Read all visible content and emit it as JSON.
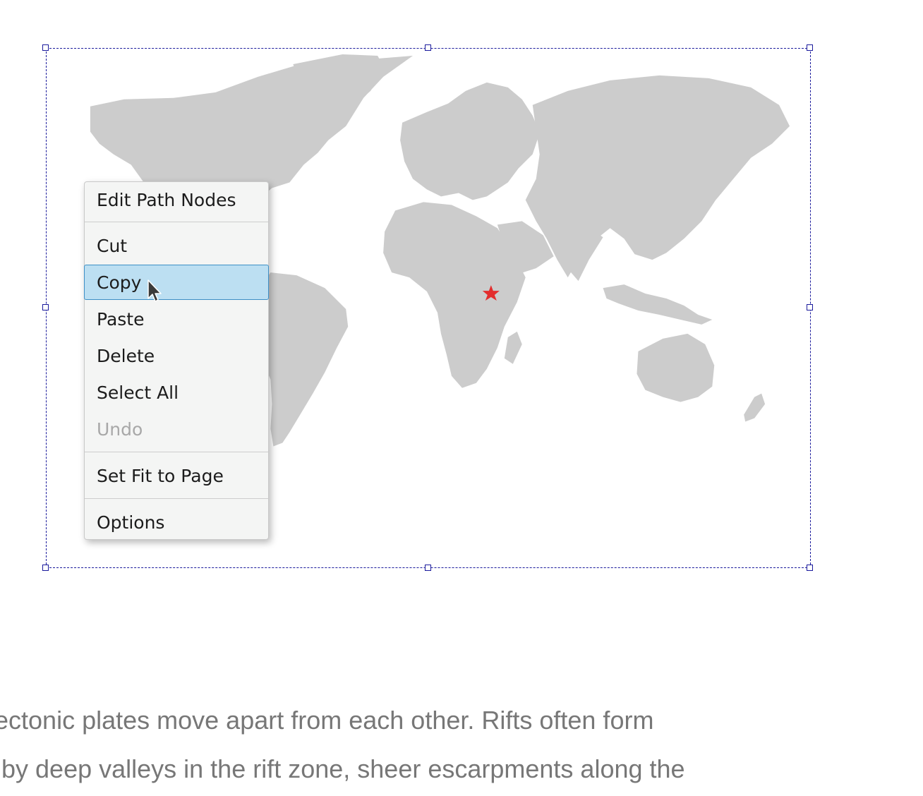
{
  "canvas": {
    "selection_color": "#1a1a9c",
    "map": {
      "land_color": "#cccccc",
      "marker": {
        "icon": "star-icon",
        "color": "#e32d2d"
      }
    }
  },
  "context_menu": {
    "items": [
      {
        "label": "Edit Path Nodes",
        "state": "enabled"
      },
      {
        "label": "Cut",
        "state": "enabled"
      },
      {
        "label": "Copy",
        "state": "highlighted"
      },
      {
        "label": "Paste",
        "state": "enabled"
      },
      {
        "label": "Delete",
        "state": "enabled"
      },
      {
        "label": "Select All",
        "state": "enabled"
      },
      {
        "label": "Undo",
        "state": "disabled"
      },
      {
        "label": "Set Fit to Page",
        "state": "enabled"
      },
      {
        "label": "Options",
        "state": "enabled"
      }
    ],
    "highlight_color": "#bcdff2",
    "highlight_border": "#3d8fc6"
  },
  "document": {
    "lines": [
      "ectonic plates move apart from each other. Rifts often form",
      " by deep valleys in the rift zone, sheer escarpments along the"
    ],
    "text_color": "#777777"
  }
}
